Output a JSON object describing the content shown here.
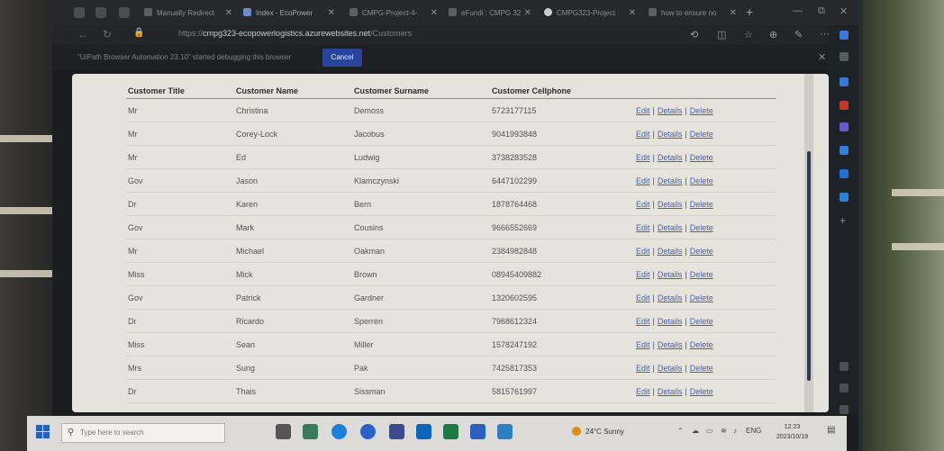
{
  "browser": {
    "tabs": [
      {
        "label": "Manually Redirect"
      },
      {
        "label": "Index - EcoPower"
      },
      {
        "label": "CMPG-Project-4-"
      },
      {
        "label": "eFundi : CMPG 32"
      },
      {
        "label": "CMPG323-Project"
      },
      {
        "label": "how to ensure no"
      }
    ],
    "url_prefix": "https://",
    "url_domain": "cmpg323-ecopowerlogistics.azurewebsites.net",
    "url_path": "/Customers",
    "debug_message": "\"UiPath Browser Automation 23.10\" started debugging this browser",
    "cancel_label": "Cancel"
  },
  "table": {
    "headers": [
      "Customer Title",
      "Customer Name",
      "Customer Surname",
      "Customer Cellphone"
    ],
    "actions": {
      "edit": "Edit",
      "details": "Details",
      "delete": "Delete",
      "separator": "|"
    },
    "rows": [
      {
        "title": "Mr",
        "name": "Christina",
        "surname": "Demoss",
        "cellphone": "5723177115"
      },
      {
        "title": "Mr",
        "name": "Corey-Lock",
        "surname": "Jacobus",
        "cellphone": "9041993848"
      },
      {
        "title": "Mr",
        "name": "Ed",
        "surname": "Ludwig",
        "cellphone": "3738283528"
      },
      {
        "title": "Gov",
        "name": "Jason",
        "surname": "Klamczynski",
        "cellphone": "6447102299"
      },
      {
        "title": "Dr",
        "name": "Karen",
        "surname": "Bern",
        "cellphone": "1878764468"
      },
      {
        "title": "Gov",
        "name": "Mark",
        "surname": "Cousins",
        "cellphone": "9666552669"
      },
      {
        "title": "Mr",
        "name": "Michael",
        "surname": "Oakman",
        "cellphone": "2384982848"
      },
      {
        "title": "Miss",
        "name": "Mick",
        "surname": "Brown",
        "cellphone": "08945409882"
      },
      {
        "title": "Gov",
        "name": "Patrick",
        "surname": "Gardner",
        "cellphone": "1320602595"
      },
      {
        "title": "Dr",
        "name": "Ricardo",
        "surname": "Sperren",
        "cellphone": "7968612324"
      },
      {
        "title": "Miss",
        "name": "Sean",
        "surname": "Miller",
        "cellphone": "1578247192"
      },
      {
        "title": "Mrs",
        "name": "Sung",
        "surname": "Pak",
        "cellphone": "7425817353"
      },
      {
        "title": "Dr",
        "name": "Thais",
        "surname": "Sissman",
        "cellphone": "5815761997"
      }
    ]
  },
  "taskbar": {
    "search_placeholder": "Type here to search",
    "weather": "24°C  Sunny",
    "language": "ENG",
    "time": "12:23",
    "date": "2023/10/19"
  },
  "colors": {
    "link": "#3a63c4",
    "cancel_button": "#27459a",
    "page_bg": "#e6e3dc"
  },
  "icons": [
    "search-icon",
    "windows-start-icon",
    "chevron-up-icon",
    "wifi-icon",
    "volume-icon",
    "notification-icon",
    "close-icon",
    "plus-icon"
  ]
}
